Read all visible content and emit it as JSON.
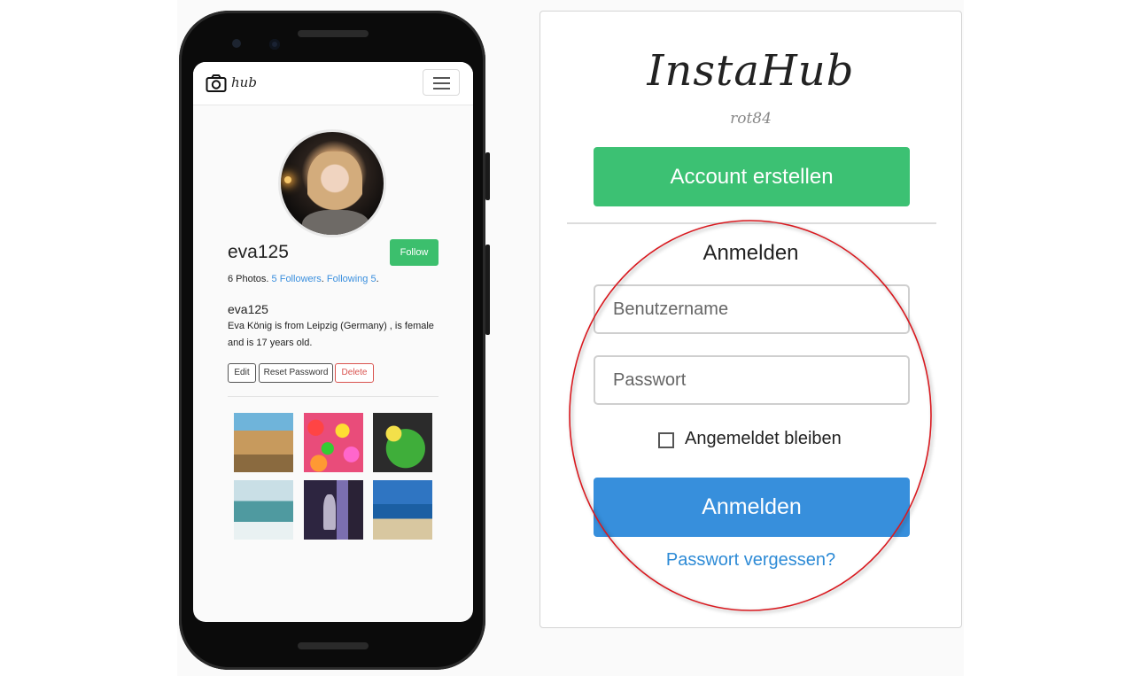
{
  "phone": {
    "logo_text": "hub",
    "username": "eva125",
    "follow_label": "Follow",
    "stats": {
      "photos": "6 Photos.",
      "followers": "5 Followers",
      "following": "Following 5",
      "sep": ".",
      "end": "."
    },
    "display_name": "eva125",
    "bio": "Eva König is from Leipzig (Germany) , is female and is 17 years old.",
    "buttons": {
      "edit": "Edit",
      "reset_password": "Reset Password",
      "delete": "Delete"
    }
  },
  "login": {
    "brand": "InstaHub",
    "brand_sub": "rot84",
    "create_account": "Account erstellen",
    "title": "Anmelden",
    "username_placeholder": "Benutzername",
    "password_placeholder": "Passwort",
    "remember_label": "Angemeldet bleiben",
    "submit": "Anmelden",
    "forgot": "Passwort vergessen?"
  },
  "colors": {
    "green": "#3cc173",
    "blue": "#378fdc",
    "link": "#2e8bd6",
    "highlight_circle": "#d9191f"
  }
}
